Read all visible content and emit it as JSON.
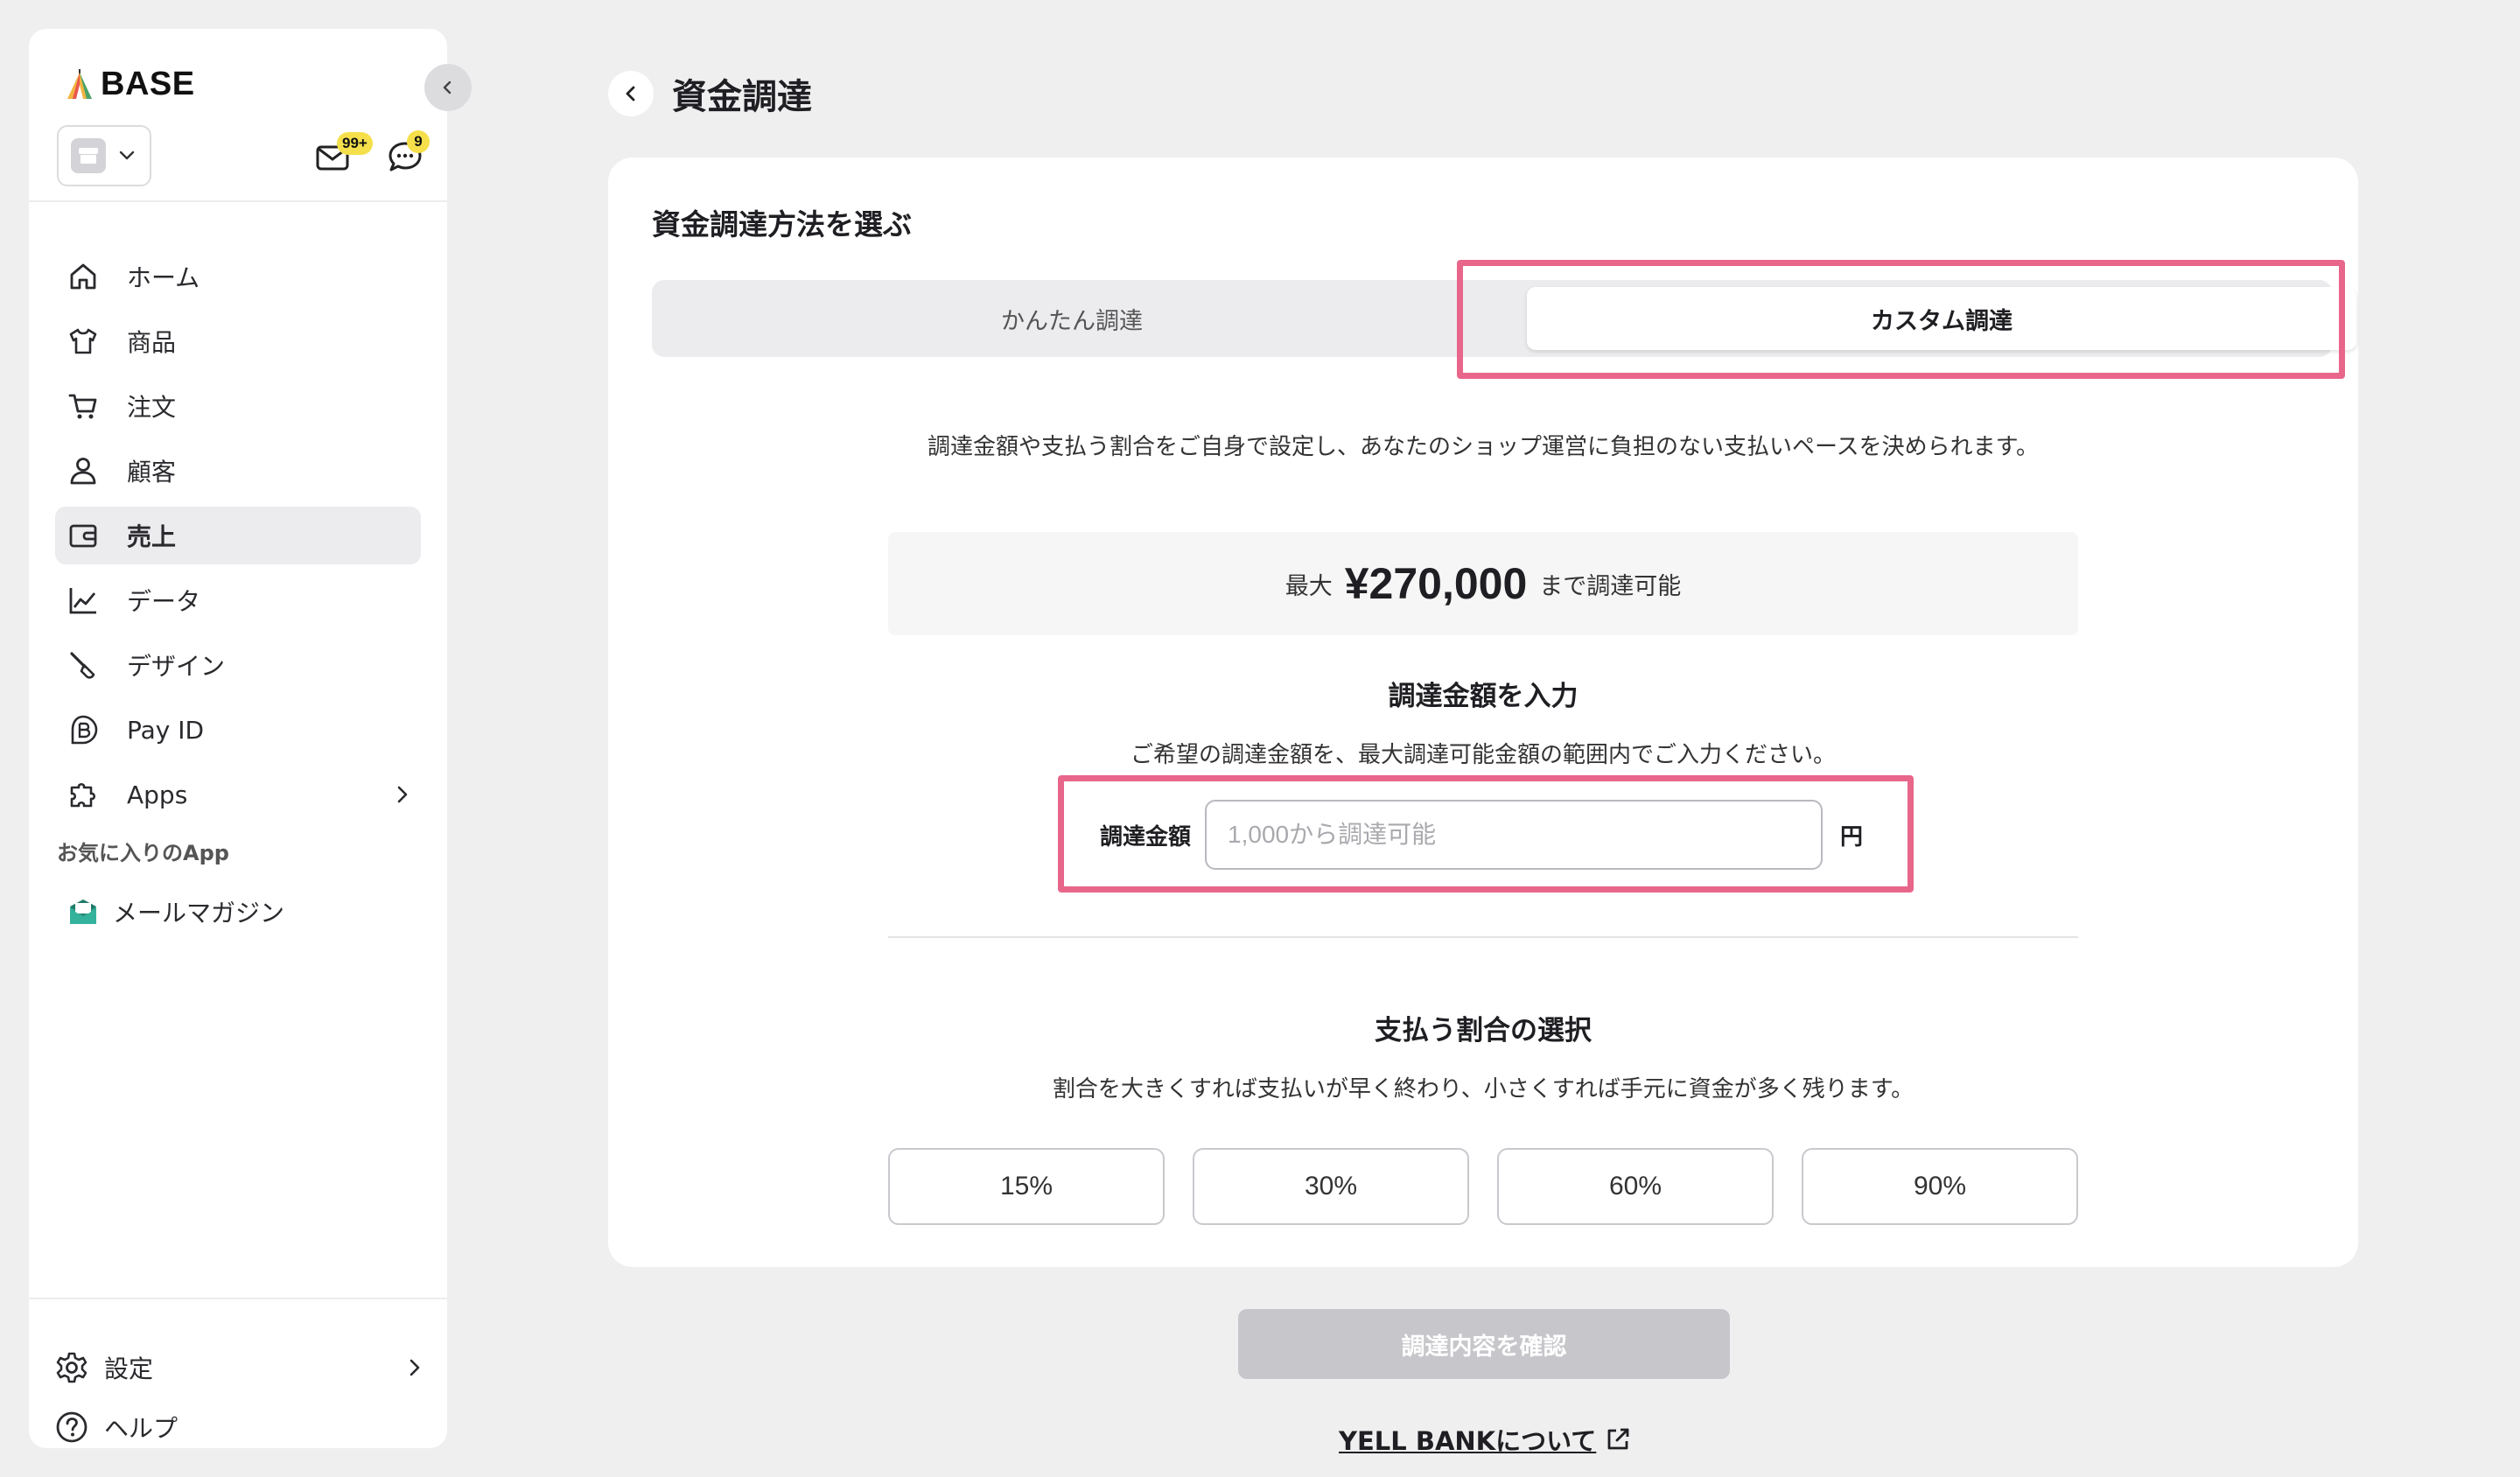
{
  "sidebar": {
    "logo": "BASE",
    "mail_badge": "99+",
    "chat_badge": "9",
    "nav_items": [
      {
        "label": "ホーム",
        "icon": "home-icon"
      },
      {
        "label": "商品",
        "icon": "shirt-icon"
      },
      {
        "label": "注文",
        "icon": "cart-icon"
      },
      {
        "label": "顧客",
        "icon": "person-icon"
      },
      {
        "label": "売上",
        "icon": "wallet-icon",
        "active": true
      },
      {
        "label": "データ",
        "icon": "chart-line-icon"
      },
      {
        "label": "デザイン",
        "icon": "brush-icon"
      },
      {
        "label": "Pay ID",
        "icon": "payid-icon"
      },
      {
        "label": "Apps",
        "icon": "puzzle-icon"
      }
    ],
    "favorites_title": "お気に入りのApp",
    "favorites": [
      {
        "label": "メールマガジン",
        "icon": "mail-magazine-icon"
      }
    ],
    "settings_label": "設定",
    "help_label": "ヘルプ"
  },
  "header": {
    "title": "資金調達"
  },
  "main": {
    "card_title": "資金調達方法を選ぶ",
    "tabs": [
      {
        "label": "かんたん調達",
        "selected": false
      },
      {
        "label": "カスタム調達",
        "selected": true
      }
    ],
    "description": "調達金額や支払う割合をご自身で設定し、あなたのショップ運営に負担のない支払いペースを決められます。",
    "max": {
      "prefix": "最大",
      "amount": "¥270,000",
      "suffix": "まで調達可能"
    },
    "amount_section": {
      "title": "調達金額を入力",
      "hint": "ご希望の調達金額を、最大調達可能金額の範囲内でご入力ください。",
      "label": "調達金額",
      "placeholder": "1,000から調達可能",
      "value": "",
      "unit": "円"
    },
    "rate_section": {
      "title": "支払う割合の選択",
      "hint": "割合を大きくすれば支払いが早く終わり、小さくすれば手元に資金が多く残ります。",
      "options": [
        "15%",
        "30%",
        "60%",
        "90%"
      ]
    },
    "confirm_button": "調達内容を確認",
    "yell_link": "YELL BANKについて"
  },
  "colors": {
    "highlight": "#e9668b",
    "badge": "#f5e04b",
    "disabled_button": "#c7c7cb",
    "background": "#efeff0"
  }
}
